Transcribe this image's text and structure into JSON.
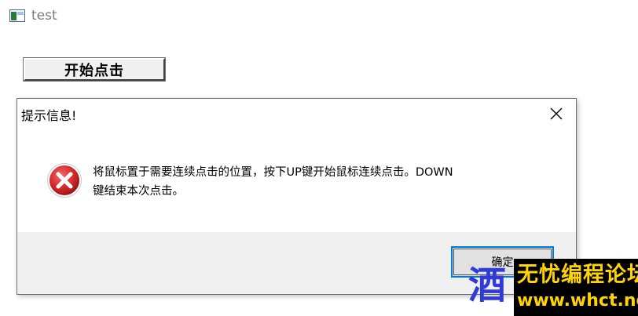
{
  "app": {
    "title": "test",
    "icon": "window-app-icon",
    "start_button_label": "开始点击"
  },
  "dialog": {
    "title": "提示信息!",
    "close_icon": "close-icon",
    "icon": "error-icon",
    "message": "将鼠标置于需要连续点击的位置，按下UP键开始鼠标连续点击。DOWN键结束本次点击。",
    "ok_label": "确定",
    "accent_color": "#0078d7",
    "error_color": "#d42b2b"
  },
  "watermark": {
    "char": "酒",
    "name": "无忧编程论坛",
    "url": "www.whct.net"
  }
}
